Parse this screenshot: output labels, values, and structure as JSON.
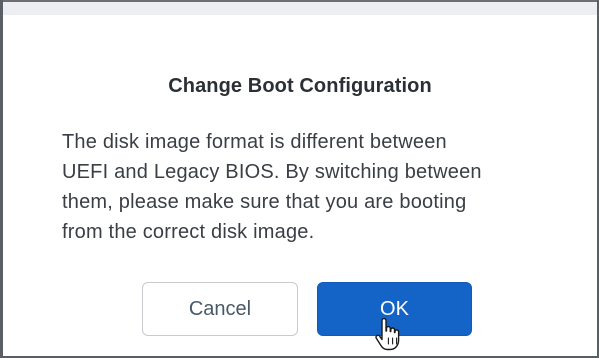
{
  "dialog": {
    "title": "Change Boot Configuration",
    "message": {
      "line1": "The disk image format is different between",
      "line2": "UEFI and Legacy BIOS. By switching between",
      "line3": "them, please make sure that you are booting",
      "line4": "from the correct disk image."
    },
    "buttons": {
      "cancel_label": "Cancel",
      "ok_label": "OK"
    }
  },
  "colors": {
    "primary": "#1464c8",
    "title_text": "#2b2f36",
    "body_text": "#3a3e45"
  },
  "icons": {
    "pointer": "hand-pointer-icon"
  }
}
